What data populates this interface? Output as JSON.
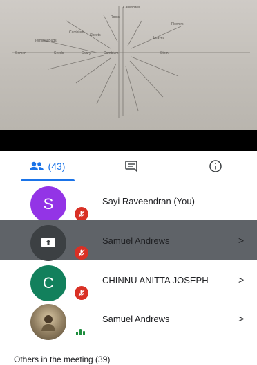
{
  "tabs": {
    "people_count": "(43)",
    "accent": "#1a73e8"
  },
  "video": {
    "words": [
      "Semen",
      "Seeds",
      "Ovary",
      "Stem",
      "Sheets",
      "Leaves",
      "Terminal Buds",
      "Cambium",
      "Cambium",
      "Roots",
      "Flowers",
      "Cauliflower"
    ]
  },
  "participants": [
    {
      "name": "Sayi Raveendran (You)",
      "initial": "S",
      "avatar_color": "#9334e6",
      "status": "muted",
      "chevron": ""
    },
    {
      "name": "Samuel Andrews",
      "initial": "",
      "avatar_color": "#3c4043",
      "status": "muted-presenting",
      "chevron": ">"
    },
    {
      "name": "CHINNU ANITTA JOSEPH",
      "initial": "C",
      "avatar_color": "#12805c",
      "status": "muted",
      "chevron": ">"
    },
    {
      "name": "Samuel Andrews",
      "initial": "",
      "avatar_color": "#8d7b5e",
      "status": "speaking",
      "chevron": ">"
    }
  ],
  "others_header": "Others in the meeting (39)"
}
